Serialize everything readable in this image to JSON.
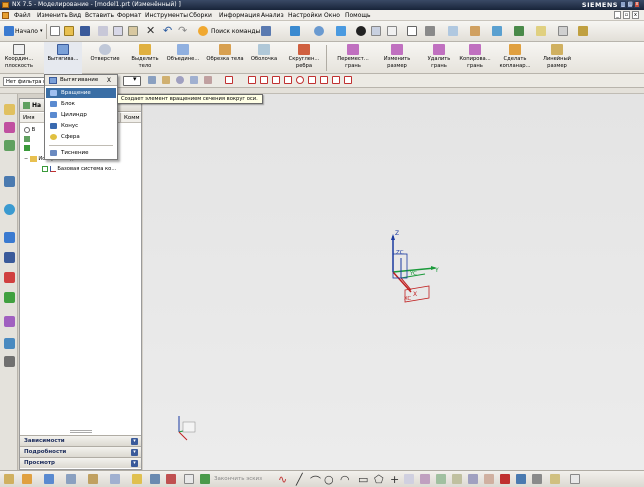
{
  "window": {
    "title": "NX 7.5 - Моделирование - [model1.prt (Изменённый) ]",
    "brand": "SIEMENS"
  },
  "menubar": {
    "items": [
      "Файл",
      "Изменить",
      "Вид",
      "Вставить",
      "Формат",
      "Инструменты",
      "Сборки",
      "Информация",
      "Анализ",
      "Настройки",
      "Окно",
      "Помощь"
    ]
  },
  "toolbar1": {
    "start_label": "Начало",
    "search_label": "Поиск команды"
  },
  "toolbar2": {
    "features": [
      "Координ... плоскость",
      "Вытягива...",
      "Отверстие",
      "Выделить тело",
      "Объедине...",
      "Обрезка тела",
      "Оболочка",
      "Скруглен... ребра",
      "Перемест... грань",
      "Изменить размер",
      "Удалить грань",
      "Копирова... грань",
      "Сделать копланар...",
      "Линейный размер"
    ]
  },
  "toolbar3": {
    "filter_value": "Нет фильтра в"
  },
  "dropdown": {
    "header": "Вытягивание",
    "close": "X",
    "items": [
      "Вращение",
      "Блок",
      "Цилиндр",
      "Конус",
      "Сфера"
    ],
    "extra": "Тиснение",
    "selected": 0
  },
  "tooltip": {
    "text": "Создает элемент вращением сечения вокруг оси."
  },
  "navigator": {
    "title": "На",
    "columns": [
      "Имя",
      "Комм"
    ],
    "rows": [
      "В",
      "История модели",
      "Базовая система ко..."
    ],
    "sections": [
      "Зависимости",
      "Подробности",
      "Просмотр"
    ]
  },
  "triad": {
    "z": "Z",
    "zc": "ZC",
    "y": "Y",
    "yc": "YC",
    "x": "X",
    "xc": "XC"
  },
  "statusbar": {
    "hint": "Закончить эскиз"
  },
  "colors": {
    "selection": "#3a6ea5",
    "titlebar": "#18243a",
    "accent_orange": "#e8a030"
  }
}
